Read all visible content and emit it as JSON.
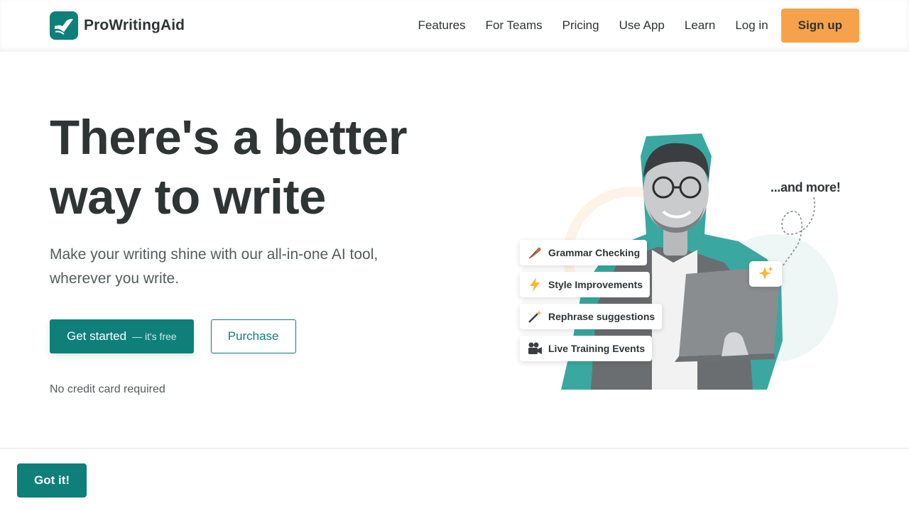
{
  "brand": {
    "name": "ProWritingAid",
    "accent": "#0f7f7a",
    "cta_color": "#f7a24b"
  },
  "nav": {
    "items": [
      "Features",
      "For Teams",
      "Pricing",
      "Use App",
      "Learn"
    ],
    "login": "Log in",
    "signup": "Sign up"
  },
  "hero": {
    "title_line1": "There's a better",
    "title_line2": "way to write",
    "subtitle_line1": "Make your writing shine with our all-in-one AI tool,",
    "subtitle_line2": "wherever you write.",
    "primary_cta": "Get started",
    "primary_cta_suffix": "— it's free",
    "secondary_cta": "Purchase",
    "note": "No credit card required"
  },
  "illustration": {
    "features": [
      {
        "label": "Grammar Checking",
        "icon": "feather-icon"
      },
      {
        "label": "Style Improvements",
        "icon": "lightning-icon"
      },
      {
        "label": "Rephrase suggestions",
        "icon": "magic-wand-icon"
      },
      {
        "label": "Live Training Events",
        "icon": "video-camera-icon"
      }
    ],
    "more": "...and more!",
    "sparkle_icon": "sparkles-icon"
  },
  "cookie": {
    "button": "Got it!"
  }
}
